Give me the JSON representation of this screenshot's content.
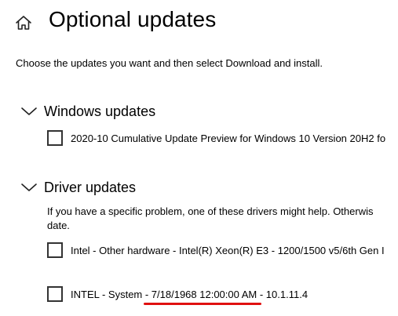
{
  "header": {
    "title": "Optional updates",
    "home_icon": "home-icon"
  },
  "description": "Choose the updates you want and then select Download and install.",
  "sections": {
    "windows": {
      "title": "Windows updates",
      "items": [
        {
          "label": "2020-10 Cumulative Update Preview for Windows 10 Version 20H2 fo",
          "checked": false
        }
      ]
    },
    "drivers": {
      "title": "Driver updates",
      "help_line_1": "If you have a specific problem, one of these drivers might help. Otherwis",
      "help_line_2": "date.",
      "items": [
        {
          "label": "Intel - Other hardware - Intel(R) Xeon(R) E3 - 1200/1500 v5/6th Gen I",
          "checked": false
        },
        {
          "label": "INTEL - System - 7/18/1968 12:00:00 AM - 10.1.11.4",
          "checked": false
        }
      ]
    }
  },
  "colors": {
    "annotation_underline": "#e01010",
    "checkbox_border": "#333333"
  }
}
